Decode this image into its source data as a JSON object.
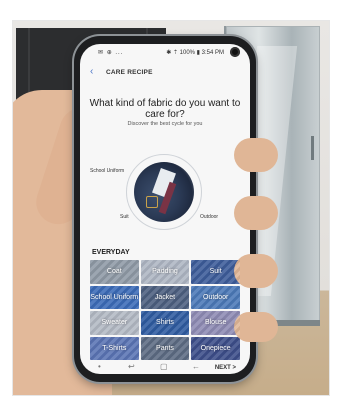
{
  "status": {
    "left": "✉ ⊕ ...",
    "right": "✱ ⇡ 100% ▮ 3:54 PM"
  },
  "app": {
    "back_icon": "chevron-left-icon",
    "title": "CARE RECIPE"
  },
  "question": "What kind of fabric do you want to care for?",
  "subtitle": "Discover the best cycle for you",
  "dial": {
    "top": "School Uniform",
    "left": "Suit",
    "right": "Outdoor"
  },
  "section_title": "EVERYDAY",
  "tiles": [
    {
      "label": "Coat",
      "color": "#8f9aa6"
    },
    {
      "label": "Padding",
      "color": "#aeb6c3"
    },
    {
      "label": "Suit",
      "color": "#3d5c9a"
    },
    {
      "label": "School Uniform",
      "color": "#3b6bb8"
    },
    {
      "label": "Jacket",
      "color": "#4c5f80"
    },
    {
      "label": "Outdoor",
      "color": "#4b79b8"
    },
    {
      "label": "Sweater",
      "color": "#b3b9c4"
    },
    {
      "label": "Shirts",
      "color": "#2f5ba0"
    },
    {
      "label": "Blouse",
      "color": "#8e8bb4"
    },
    {
      "label": "T-Shirts",
      "color": "#5a74b4"
    },
    {
      "label": "Pants",
      "color": "#5c6b83"
    },
    {
      "label": "Onepiece",
      "color": "#3d4e8a"
    }
  ],
  "next_label": "NEXT >",
  "nav": {
    "dot": "•",
    "recent": "↩",
    "home": "▢",
    "back": "←"
  }
}
